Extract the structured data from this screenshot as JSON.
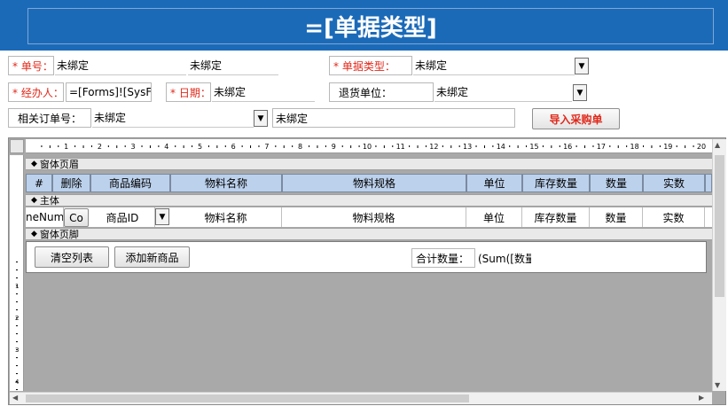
{
  "title": "=[单据类型]",
  "fields": {
    "doc_no_label": "* 单号：",
    "doc_no_value": "未绑定",
    "doc_no_value2": "未绑定",
    "doc_type_label": "* 单据类型：",
    "doc_type_value": "未绑定",
    "handler_label": "* 经办人：",
    "handler_value": "=[Forms]![SysFr",
    "date_label": "* 日期：",
    "date_value": "未绑定",
    "return_unit_label": "退货单位：",
    "return_unit_value": "未绑定",
    "related_order_label": "相关订单号：",
    "related_order_value": "未绑定",
    "related_order_value2": "未绑定",
    "import_button": "导入采购单"
  },
  "subform": {
    "ruler_ticks": [
      "1",
      "2",
      "3",
      "4",
      "5",
      "6",
      "7",
      "8",
      "9",
      "10",
      "11",
      "12",
      "13",
      "14",
      "15",
      "16",
      "17",
      "18",
      "19",
      "20"
    ],
    "section_header": "窗体页眉",
    "section_body": "主体",
    "section_footer": "窗体页脚",
    "columns": [
      "#",
      "删除",
      "商品编码",
      "物料名称",
      "物料规格",
      "单位",
      "库存数量",
      "数量",
      "实数"
    ],
    "row": {
      "num": "neNum",
      "delete": "Co",
      "code": "商品ID",
      "name": "物料名称",
      "spec": "物料规格",
      "unit": "单位",
      "stock": "库存数量",
      "qty": "数量",
      "actual": "实数"
    },
    "clear_button": "清空列表",
    "add_button": "添加新商品",
    "total_label": "合计数量：",
    "total_value": "(Sum([数量"
  },
  "vruler_ticks": [
    "1",
    "2",
    "3",
    "4"
  ],
  "colors": {
    "header_bg": "#1b6ab8",
    "required": "#e0281a",
    "column_header": "#bcd1ec"
  }
}
